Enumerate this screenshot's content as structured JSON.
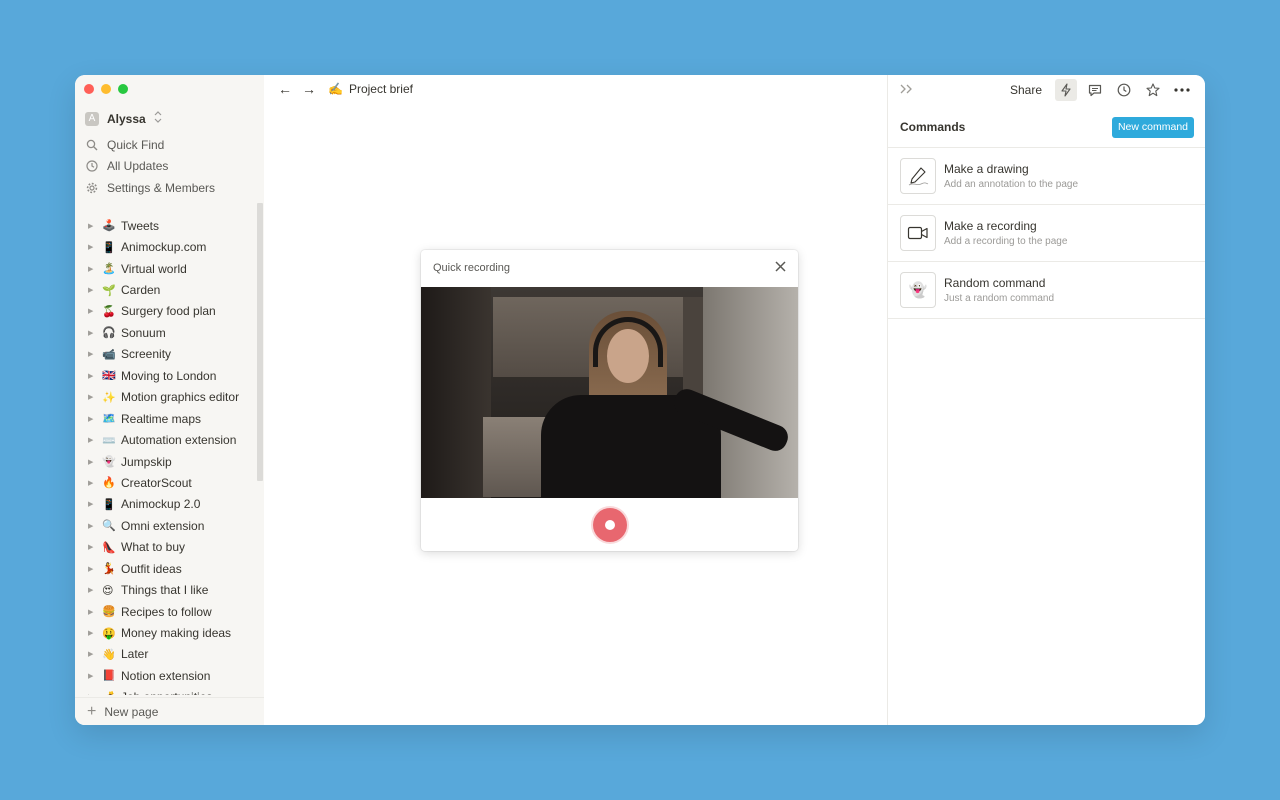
{
  "sidebar": {
    "workspace": {
      "avatar": "A",
      "name": "Alyssa",
      "chevron": "⌃⌄"
    },
    "top_links": [
      {
        "icon": "search-icon",
        "label": "Quick Find"
      },
      {
        "icon": "clock-icon",
        "label": "All Updates"
      },
      {
        "icon": "gear-icon",
        "label": "Settings & Members"
      }
    ],
    "pages": [
      {
        "emoji": "🕹️",
        "label": "Tweets"
      },
      {
        "emoji": "📱",
        "label": "Animockup.com"
      },
      {
        "emoji": "🏝️",
        "label": "Virtual world"
      },
      {
        "emoji": "🌱",
        "label": "Carden"
      },
      {
        "emoji": "🍒",
        "label": "Surgery food plan"
      },
      {
        "emoji": "🎧",
        "label": "Sonuum"
      },
      {
        "emoji": "📹",
        "label": "Screenity"
      },
      {
        "emoji": "🇬🇧",
        "label": "Moving to London"
      },
      {
        "emoji": "✨",
        "label": "Motion graphics editor"
      },
      {
        "emoji": "🗺️",
        "label": "Realtime maps"
      },
      {
        "emoji": "⌨️",
        "label": "Automation extension"
      },
      {
        "emoji": "👻",
        "label": "Jumpskip"
      },
      {
        "emoji": "🔥",
        "label": "CreatorScout"
      },
      {
        "emoji": "📱",
        "label": "Animockup 2.0"
      },
      {
        "emoji": "🔍",
        "label": "Omni extension"
      },
      {
        "emoji": "👠",
        "label": "What to buy"
      },
      {
        "emoji": "💃",
        "label": "Outfit ideas"
      },
      {
        "emoji": "😍",
        "label": "Things that I like"
      },
      {
        "emoji": "🍔",
        "label": "Recipes to follow"
      },
      {
        "emoji": "🤑",
        "label": "Money making ideas"
      },
      {
        "emoji": "👋",
        "label": "Later"
      },
      {
        "emoji": "📕",
        "label": "Notion extension"
      },
      {
        "emoji": "💰",
        "label": "Job opportunities"
      }
    ],
    "new_page": "New page"
  },
  "main": {
    "breadcrumb": {
      "back": "←",
      "forward": "→",
      "emoji": "✍️",
      "title": "Project brief"
    },
    "modal": {
      "title": "Quick recording",
      "close": "✕"
    }
  },
  "panel": {
    "share": "Share",
    "commands_title": "Commands",
    "new_command": "New command",
    "commands": [
      {
        "icon": "pencil-icon",
        "title": "Make a drawing",
        "subtitle": "Add an annotation to the page"
      },
      {
        "icon": "video-camera-icon",
        "title": "Make a recording",
        "subtitle": "Add a recording to the page"
      },
      {
        "icon": "ghost-icon",
        "title": "Random command",
        "subtitle": "Just a random command"
      }
    ]
  },
  "colors": {
    "accent": "#2eaadc",
    "record": "#e8676f",
    "background": "#58a8da"
  }
}
